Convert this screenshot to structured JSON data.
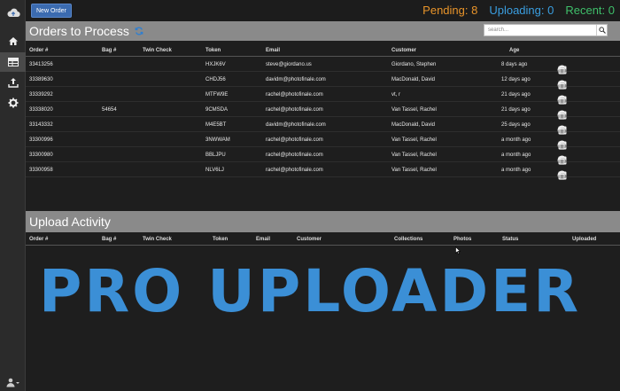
{
  "topbar": {
    "new_order_label": "New Order",
    "pending": "Pending: 8",
    "uploading": "Uploading: 0",
    "recent": "Recent: 0"
  },
  "colors": {
    "pending": "#e8942a",
    "uploading": "#3a9ee0",
    "recent": "#3fbf6a",
    "accent": "#3b6bb0"
  },
  "sidebar": {
    "items": [
      {
        "icon": "cloud-logo-icon"
      },
      {
        "icon": "home-icon"
      },
      {
        "icon": "orders-table-icon"
      },
      {
        "icon": "upload-icon"
      },
      {
        "icon": "gear-icon"
      },
      {
        "icon": "user-menu-icon"
      }
    ]
  },
  "orders": {
    "title": "Orders to Process",
    "search_placeholder": "search...",
    "columns": [
      "Order #",
      "Bag #",
      "Twin Check",
      "Token",
      "Email",
      "Customer",
      "Age"
    ],
    "rows": [
      {
        "order": "33413256",
        "bag": "",
        "twin": "",
        "token": "HXJK6V",
        "email": "steve@giordano.us",
        "customer": "Giordano, Stephen",
        "age": "8 days ago"
      },
      {
        "order": "33389630",
        "bag": "",
        "twin": "",
        "token": "CHDJ56",
        "email": "davidm@photofinale.com",
        "customer": "MacDonald, David",
        "age": "12 days ago"
      },
      {
        "order": "33339292",
        "bag": "",
        "twin": "",
        "token": "MTFW9E",
        "email": "rachel@photofinale.com",
        "customer": "vt, r",
        "age": "21 days ago"
      },
      {
        "order": "33338020",
        "bag": "54654",
        "twin": "",
        "token": "9CMSDA",
        "email": "rachel@photofinale.com",
        "customer": "Van Tassel, Rachel",
        "age": "21 days ago"
      },
      {
        "order": "33143332",
        "bag": "",
        "twin": "",
        "token": "M4E5BT",
        "email": "davidm@photofinale.com",
        "customer": "MacDonald, David",
        "age": "25 days ago"
      },
      {
        "order": "33300996",
        "bag": "",
        "twin": "",
        "token": "3NWWAM",
        "email": "rachel@photofinale.com",
        "customer": "Van Tassel, Rachel",
        "age": "a month ago"
      },
      {
        "order": "33300980",
        "bag": "",
        "twin": "",
        "token": "BBLJPU",
        "email": "rachel@photofinale.com",
        "customer": "Van Tassel, Rachel",
        "age": "a month ago"
      },
      {
        "order": "33300958",
        "bag": "",
        "twin": "",
        "token": "NLV6LJ",
        "email": "rachel@photofinale.com",
        "customer": "Van Tassel, Rachel",
        "age": "a month ago"
      }
    ]
  },
  "upload": {
    "title": "Upload Activity",
    "columns": [
      "Order #",
      "Bag #",
      "Twin Check",
      "Token",
      "Email",
      "Customer",
      "Collections",
      "Photos",
      "Status",
      "Uploaded"
    ]
  },
  "brand_text": "PRO UPLOADER"
}
